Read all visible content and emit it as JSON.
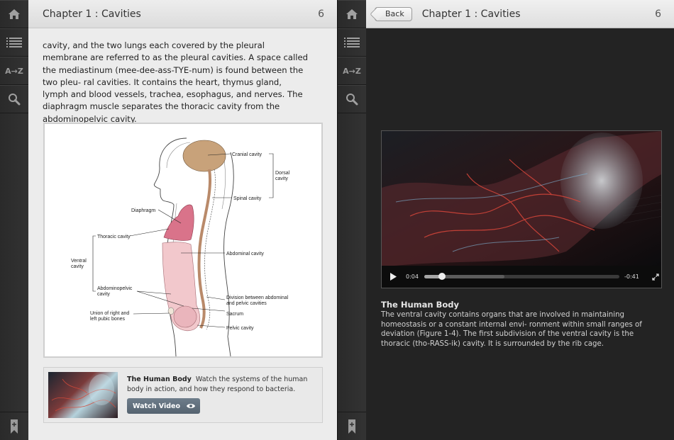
{
  "left_screen": {
    "sidebar": {
      "az_label": "A→Z"
    },
    "header": {
      "title": "Chapter 1 : Cavities",
      "page": "6"
    },
    "body_text": "cavity, and the two lungs each covered by the pleural membrane are referred to as the pleural cavities. A space called the mediastinum (mee-dee-ass-TYE-num) is found between the two pleu- ral cavities. It contains the heart, thymus gland, lymph and blood vessels, trachea, esophagus, and nerves. The diaphragm muscle separates the thoracic cavity from the abdominopelvic cavity.",
    "figure_labels": {
      "cranial_cavity": "Cranial cavity",
      "dorsal_cavity_1": "Dorsal",
      "dorsal_cavity_2": "cavity",
      "spinal_cavity": "Spinal cavity",
      "diaphragm": "Diaphragm",
      "thoracic_cavity": "Thoracic cavity",
      "abdominal_cavity": "Abdominal cavity",
      "ventral_cavity_1": "Ventral",
      "ventral_cavity_2": "cavity",
      "abdominopelvic_1": "Abdominopelvic",
      "abdominopelvic_2": "cavity",
      "division_1": "Division between abdominal",
      "division_2": "and pelvic cavities",
      "sacrum": "Sacrum",
      "union_1": "Union of right and",
      "union_2": "left pubic bones",
      "pelvic_cavity": "Pelvic cavity"
    },
    "video_card": {
      "title": "The Human Body",
      "description": "Watch the systems of the human body in action, and how they respond to bacteria.",
      "button_label": "Watch Video"
    }
  },
  "right_screen": {
    "sidebar": {
      "az_label": "A→Z"
    },
    "header": {
      "back_label": "Back",
      "title": "Chapter 1 : Cavities",
      "page": "6"
    },
    "player": {
      "current_time": "0:04",
      "remaining_time": "-0:41",
      "progress": 0.09,
      "buffered": 0.41
    },
    "caption": {
      "title": "The Human Body",
      "text": "The ventral cavity contains organs that are involved in maintaining homeostasis or a constant internal envi- ronment within small ranges of deviation (Figure 1-4). The first subdivision of the ventral cavity is the thoracic (tho-RASS-ik) cavity. It is surrounded by the rib cage."
    }
  }
}
